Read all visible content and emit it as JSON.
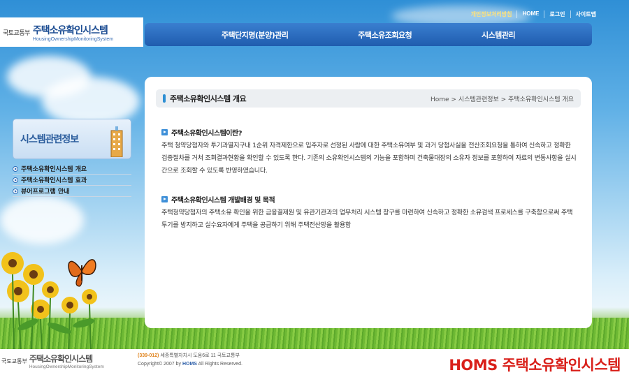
{
  "top_links": [
    "개인정보처리방침",
    "HOME",
    "로그인",
    "사이트맵"
  ],
  "logo": {
    "ministry": "국토교통부",
    "title": "주택소유확인시스템",
    "subtitle": "HousingOwnershipMonitoringSystem"
  },
  "nav": {
    "items": [
      "주택단지명(분양)관리",
      "주택소유조회요청",
      "시스템관리"
    ]
  },
  "sidebar": {
    "banner": "시스템관련정보",
    "items": [
      "주택소유확인시스템 개요",
      "주택소유확인시스템 효과",
      "뷰어프로그램 안내"
    ]
  },
  "main": {
    "title": "주택소유확인시스템 개요",
    "breadcrumb": "Home > 시스템관련정보 > 주택소유확인시스템 개요",
    "sections": [
      {
        "heading": "주택소유확인시스템이란?",
        "body": "주택 청약당첨자와 투기과열지구내 1순위 자격제한으로 입주자로 선정된 사람에 대한 주택소유여부 및 과거 당첨사실을 전산조회요청을 통하여 신속하고 정확한 검증절차를 거쳐 조회결과현황을 확인할 수 있도록 한다. 기존의 소유확인시스템의 기능을 포함하며 건축물대장의 소유자 정보를 포함하여 자료의 변동사항을 실시간으로 조회할 수 있도록 반영하였습니다."
      },
      {
        "heading": "주택소유확인시스템 개발배경 및 목적",
        "body": "주택청약당첨자의 주택소유 확인을 위한 금융결제원 및 유관기관과의 업무처리 시스템 창구를 마련하여 신속하고 정확한 소유검색 프로세스를 구축함으로써 주택투기를 방지하고 실수요자에게 주택을 공급하기 위해 주택전산망을 활용함"
      }
    ]
  },
  "footer": {
    "ministry": "국토교통부",
    "title": "주택소유확인시스템",
    "subtitle": "HousingOwnershipMonitoringSystem",
    "zip": "(339-012)",
    "address": "세종특별자치시 도움6로 11 국토교통부",
    "copyright_pre": "Copyright© 2007 by",
    "copyright_brand": "HOMS",
    "copyright_post": "All Rights Reserved."
  },
  "watermark": "HOMS 주택소유확인시스템",
  "colors": {
    "nav": "#2d6bc0",
    "watermark": "#d9201a",
    "accent": "#3d8fd8"
  }
}
